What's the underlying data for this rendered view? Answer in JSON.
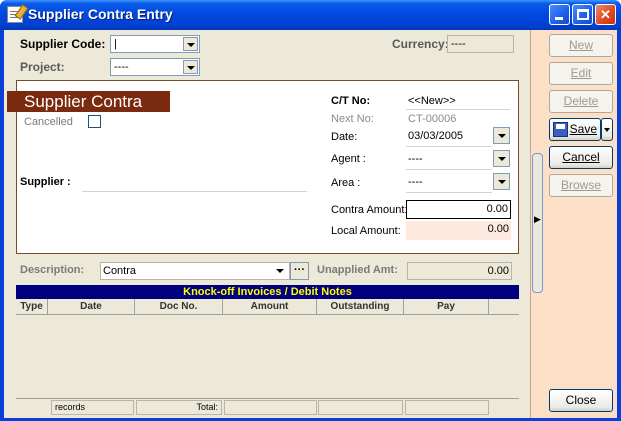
{
  "window": {
    "title": "Supplier Contra Entry"
  },
  "header": {
    "supplier_code_label": "Supplier Code:",
    "supplier_code_value": "|",
    "project_label": "Project:",
    "project_value": "----",
    "currency_label": "Currency:",
    "currency_value": "----"
  },
  "form": {
    "banner": "Supplier Contra",
    "cancelled_label": "Cancelled",
    "supplier_label": "Supplier :",
    "ct_no_label": "C/T No:",
    "ct_no_value": "<<New>>",
    "next_no_label": "Next No:",
    "next_no_value": "CT-00006",
    "date_label": "Date:",
    "date_value": "03/03/2005",
    "agent_label": "Agent :",
    "agent_value": "----",
    "area_label": "Area :",
    "area_value": "----",
    "contra_amount_label": "Contra Amount:",
    "contra_amount_value": "0.00",
    "local_amount_label": "Local Amount:",
    "local_amount_value": "0.00"
  },
  "description": {
    "label": "Description:",
    "value": "Contra",
    "unapplied_label": "Unapplied Amt:",
    "unapplied_value": "0.00"
  },
  "grid": {
    "title": "Knock-off Invoices / Debit Notes",
    "columns": [
      "Type",
      "Date",
      "Doc No.",
      "Amount",
      "Outstanding",
      "Pay"
    ],
    "footer_records": "records",
    "footer_total": "Total:"
  },
  "buttons": {
    "new": "New",
    "edit": "Edit",
    "delete": "Delete",
    "save": "Save",
    "cancel": "Cancel",
    "browse": "Browse",
    "close": "Close"
  },
  "colors": {
    "banner": "#7a2a0e",
    "grid_header_bg": "#00007e",
    "grid_header_text": "#ffff00",
    "right_panel": "#fbdfc6"
  }
}
